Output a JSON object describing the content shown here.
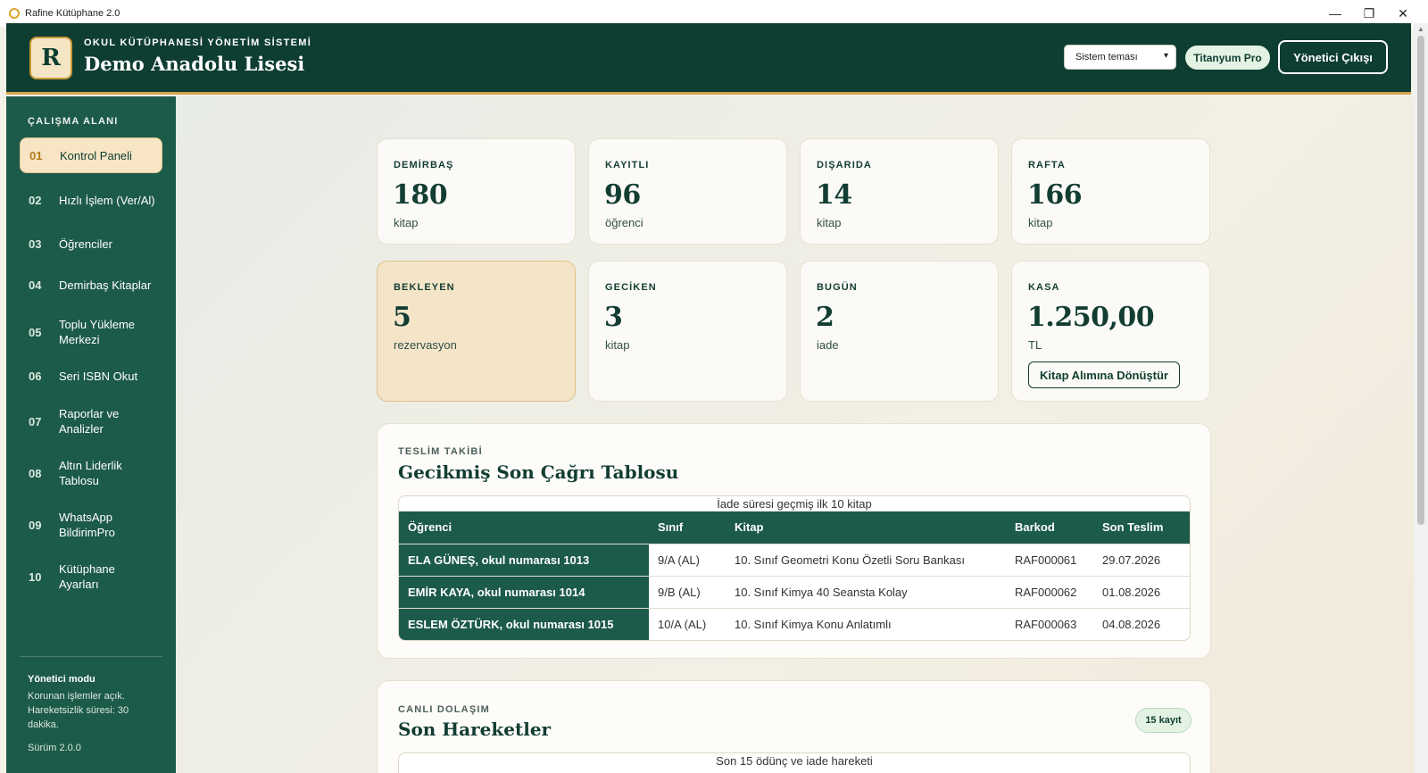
{
  "window": {
    "title": "Rafine Kütüphane 2.0",
    "minimize": "—",
    "maximize": "❐",
    "close": "✕"
  },
  "header": {
    "logo_letter": "R",
    "subtitle": "OKUL KÜTÜPHANESİ YÖNETİM SİSTEMİ",
    "school_name": "Demo Anadolu Lisesi",
    "theme_select": {
      "value": "Sistem teması"
    },
    "pro_badge": "Titanyum Pro",
    "logout_label": "Yönetici Çıkışı"
  },
  "sidebar": {
    "section_title": "ÇALIŞMA ALANI",
    "items": [
      {
        "num": "01",
        "label": "Kontrol Paneli",
        "active": true
      },
      {
        "num": "02",
        "label": "Hızlı İşlem (Ver/Al)"
      },
      {
        "num": "03",
        "label": "Öğrenciler"
      },
      {
        "num": "04",
        "label": "Demirbaş Kitaplar"
      },
      {
        "num": "05",
        "label": "Toplu Yükleme Merkezi"
      },
      {
        "num": "06",
        "label": "Seri ISBN Okut"
      },
      {
        "num": "07",
        "label": "Raporlar ve Analizler"
      },
      {
        "num": "08",
        "label": "Altın Liderlik Tablosu"
      },
      {
        "num": "09",
        "label": "WhatsApp BildirimPro"
      },
      {
        "num": "10",
        "label": "Kütüphane Ayarları"
      }
    ],
    "mode_title": "Yönetici modu",
    "mode_note": "Korunan işlemler açık. Hareketsizlik süresi: 30 dakika.",
    "version": "Sürüm 2.0.0"
  },
  "stats": [
    {
      "label": "DEMİRBAŞ",
      "value": "180",
      "unit": "kitap"
    },
    {
      "label": "KAYITLI",
      "value": "96",
      "unit": "öğrenci"
    },
    {
      "label": "DIŞARIDA",
      "value": "14",
      "unit": "kitap"
    },
    {
      "label": "RAFTA",
      "value": "166",
      "unit": "kitap"
    },
    {
      "label": "BEKLEYEN",
      "value": "5",
      "unit": "rezervasyon",
      "highlight": true
    },
    {
      "label": "GECİKEN",
      "value": "3",
      "unit": "kitap"
    },
    {
      "label": "BUGÜN",
      "value": "2",
      "unit": "iade"
    },
    {
      "label": "KASA",
      "value": "1.250,00",
      "unit": "TL",
      "button": "Kitap Alımına Dönüştür"
    }
  ],
  "overdue": {
    "eyebrow": "TESLİM TAKİBİ",
    "title": "Gecikmiş Son Çağrı Tablosu",
    "caption": "İade süresi geçmiş ilk 10 kitap",
    "columns": [
      "Öğrenci",
      "Sınıf",
      "Kitap",
      "Barkod",
      "Son Teslim"
    ],
    "rows": [
      [
        "ELA GÜNEŞ, okul numarası 1013",
        "9/A (AL)",
        "10. Sınıf Geometri Konu Özetli Soru Bankası",
        "RAF000061",
        "29.07.2026"
      ],
      [
        "EMİR KAYA, okul numarası 1014",
        "9/B (AL)",
        "10. Sınıf Kimya 40 Seansta Kolay",
        "RAF000062",
        "01.08.2026"
      ],
      [
        "ESLEM ÖZTÜRK, okul numarası 1015",
        "10/A (AL)",
        "10. Sınıf Kimya Konu Anlatımlı",
        "RAF000063",
        "04.08.2026"
      ]
    ]
  },
  "recent": {
    "eyebrow": "CANLI DOLAŞIM",
    "title": "Son Hareketler",
    "count": "15 kayıt",
    "caption": "Son 15 ödünç ve iade hareketi"
  }
}
